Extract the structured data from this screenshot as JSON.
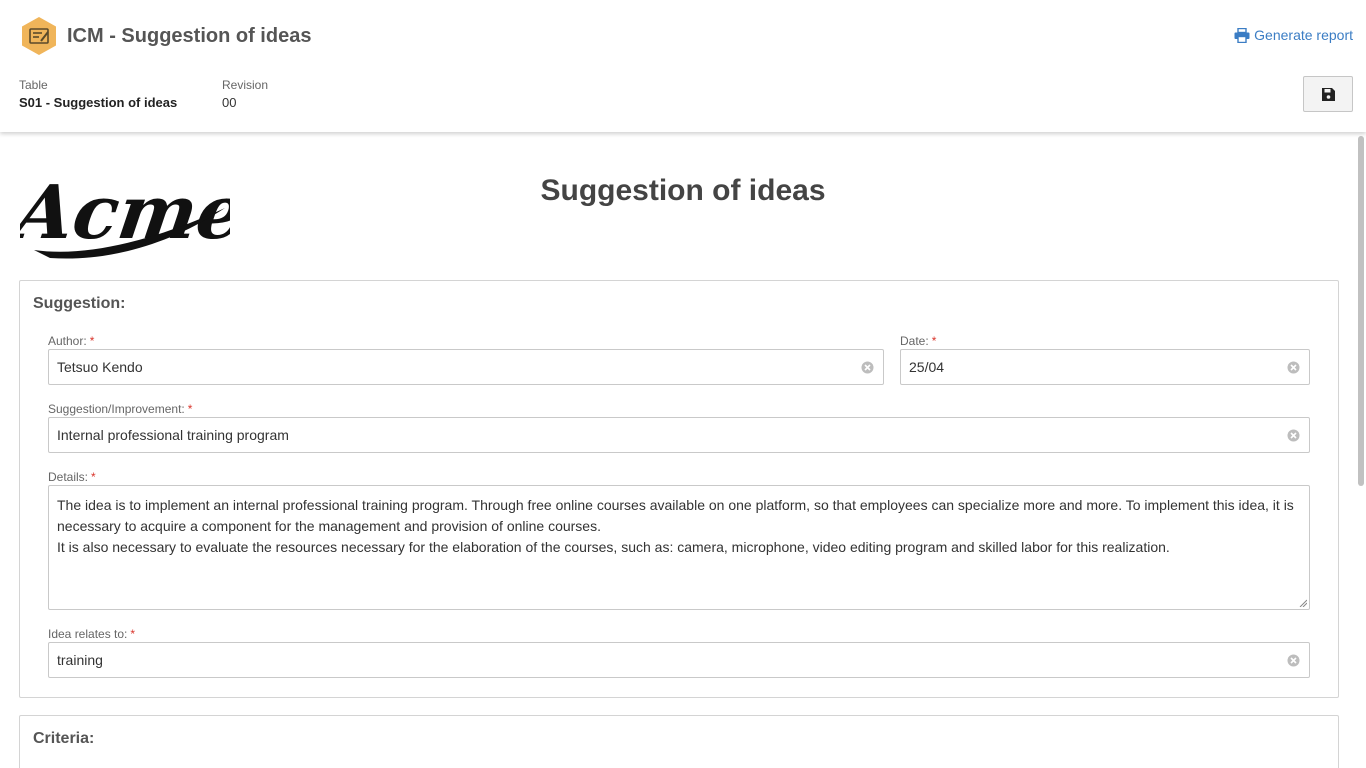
{
  "header": {
    "app_title": "ICM - Suggestion of ideas",
    "generate_report_label": "Generate report",
    "table_label": "Table",
    "table_value": "S01 - Suggestion of ideas",
    "revision_label": "Revision",
    "revision_value": "00"
  },
  "form": {
    "logo_text": "Acme",
    "title": "Suggestion of ideas",
    "suggestion_section": {
      "title": "Suggestion:",
      "author_label": "Author:",
      "author_value": "Tetsuo Kendo",
      "date_label": "Date:",
      "date_value": "25/04",
      "suggestion_label": "Suggestion/Improvement:",
      "suggestion_value": "Internal professional training program",
      "details_label": "Details:",
      "details_line1": "The idea is to implement an internal professional training program. Through free online courses available on one platform, so that employees can specialize more and more. To implement this idea, it is",
      "details_line2": "necessary to acquire a component for the management and provision of online courses.",
      "details_line3": "It is also necessary to evaluate the resources necessary for the elaboration of the courses, such as: camera, microphone, video editing program and skilled labor for this realization.",
      "relates_label": "Idea relates to:",
      "relates_value": "training",
      "required_mark": "*"
    },
    "criteria_section": {
      "title": "Criteria:"
    }
  },
  "colors": {
    "accent": "#3b7dc4",
    "app_icon": "#f0b55a",
    "required": "#d9342b"
  },
  "icons": {
    "app": "edit-form-icon",
    "report": "printer-icon",
    "save": "floppy-disk-icon",
    "clear": "clear-circle-icon"
  }
}
